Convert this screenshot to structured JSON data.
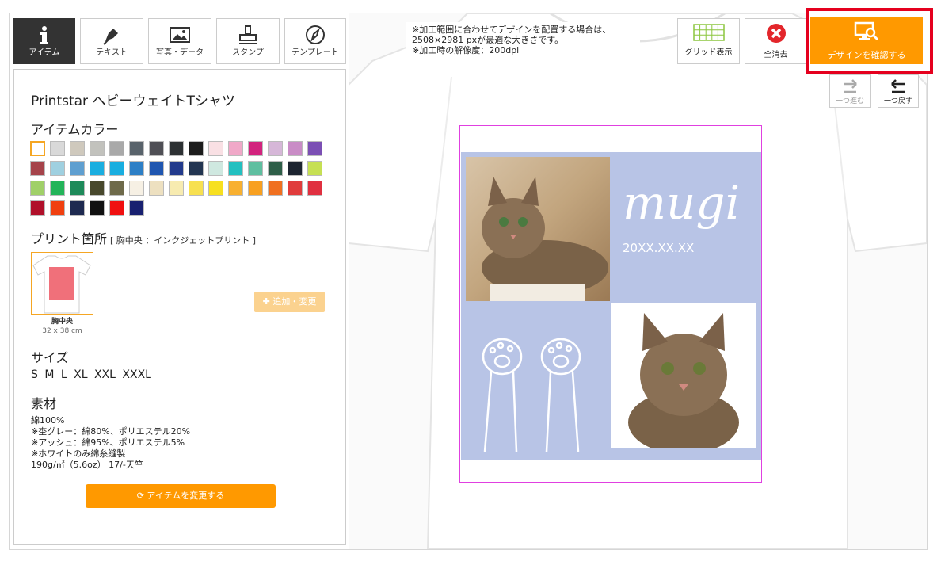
{
  "toolbar": {
    "item": "アイテム",
    "text": "テキスト",
    "photo": "写真・データ",
    "stamp": "スタンプ",
    "template": "テンプレート"
  },
  "notice": {
    "line1": "※加工範囲に合わせてデザインを配置する場合は、",
    "line2": "2508×2981 pxが最適な大きさです。",
    "line3": "※加工時の解像度：200dpi"
  },
  "rightbar": {
    "grid": "グリッド表示",
    "clear": "全消去",
    "confirm": "デザインを確認する",
    "redo": "一つ進む",
    "undo": "一つ戻す"
  },
  "panel": {
    "product": "Printstar ヘビーウェイトTシャツ",
    "color_title": "アイテムカラー",
    "print_title": "プリント箇所",
    "print_sub": "[ 胸中央 ：インクジェットプリント ]",
    "thumb_label": "胸中央",
    "thumb_size": "32 x 38 cm",
    "add_btn": "✚ 追加・変更",
    "size_title": "サイズ",
    "sizes": "S  M  L  XL  XXL  XXXL",
    "material_title": "素材",
    "material_text": "綿100%\n※杢グレー：綿80%、ポリエステル20%\n※アッシュ：綿95%、ポリエステル5%\n※ホワイトのみ綿糸縫製\n190g/㎡（5.6oz） 17/-天竺",
    "change_btn": "アイテムを変更する"
  },
  "colors": [
    "#ffffff",
    "#d9d9d9",
    "#cfc9bd",
    "#c2c2bd",
    "#a9a9a9",
    "#59636b",
    "#4f4f55",
    "#2d3133",
    "#1c1c1c",
    "#f9e0e4",
    "#f0a8c8",
    "#d2237e",
    "#d6b7d8",
    "#c98cc6",
    "#7b4fb4",
    "#a5434a",
    "#9fd0e0",
    "#5f9fd0",
    "#1aaee0",
    "#19aee0",
    "#2d7fc6",
    "#1f56b0",
    "#223a8c",
    "#233551",
    "#cfe8e0",
    "#23c0c0",
    "#5fbfa0",
    "#2e5e48",
    "#1c2430",
    "#c6e053",
    "#a0d068",
    "#24b45a",
    "#1e8a5a",
    "#48482c",
    "#6e6a4a",
    "#f6f0e4",
    "#ede0c0",
    "#f7ebb0",
    "#f7e050",
    "#f7e020",
    "#f8b030",
    "#f8a020",
    "#f07020",
    "#e03c3c",
    "#e03040",
    "#b0102a",
    "#f04010",
    "#1e2a50",
    "#101010",
    "#f01010",
    "#182070"
  ],
  "design": {
    "title": "mugi",
    "date": "20XX.XX.XX"
  }
}
